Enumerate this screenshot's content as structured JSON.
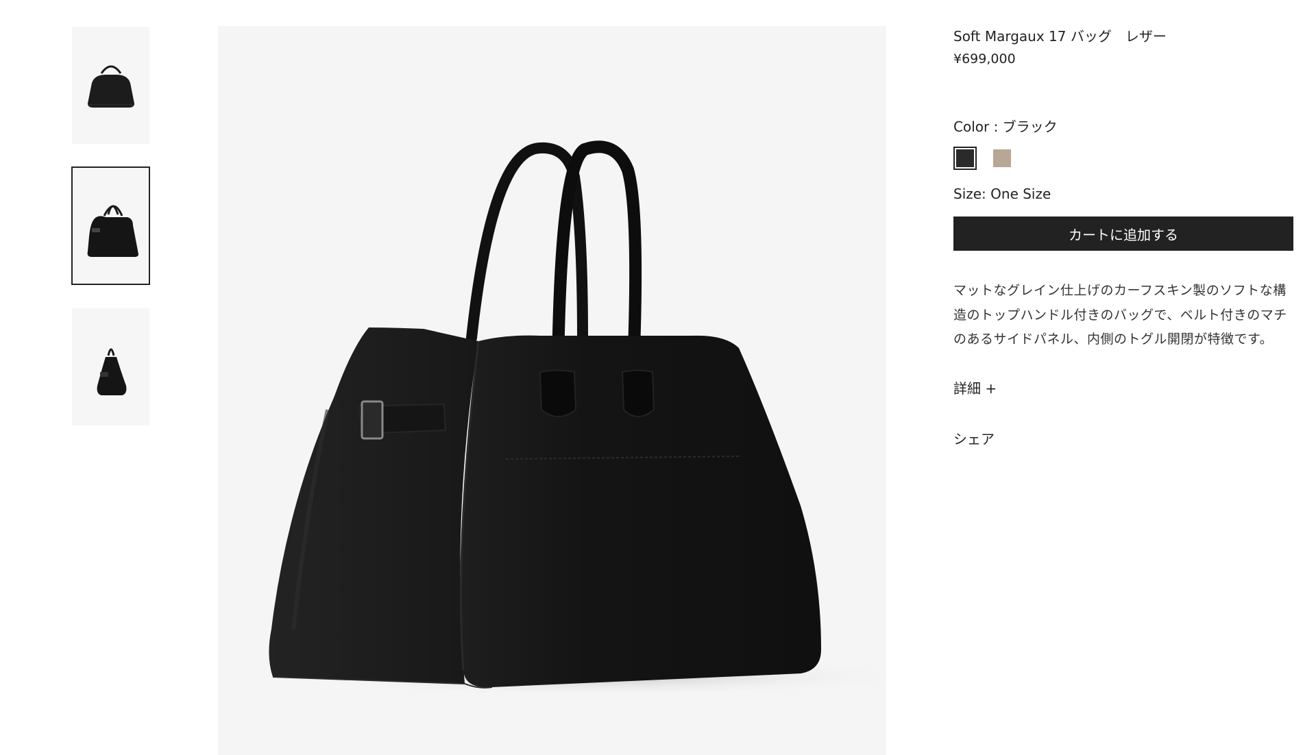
{
  "product": {
    "title": "Soft Margaux 17 バッグ　レザー",
    "price": "¥699,000"
  },
  "color": {
    "label": "Color : ブラック",
    "swatches": [
      {
        "name": "black",
        "hex": "#2a2a2a",
        "selected": true
      },
      {
        "name": "taupe",
        "hex": "#b7a794",
        "selected": false
      }
    ]
  },
  "size": {
    "label": "Size: One Size"
  },
  "actions": {
    "add_to_cart": "カートに追加する",
    "details": "詳細 +",
    "share": "シェア"
  },
  "description": "マットなグレイン仕上げのカーフスキン製のソフトな構造のトップハンドル付きのバッグで、ベルト付きのマチのあるサイドパネル、内側のトグル開閉が特徴です。",
  "thumbnails": [
    {
      "name": "front-view",
      "selected": false
    },
    {
      "name": "angled-view",
      "selected": true
    },
    {
      "name": "side-view",
      "selected": false
    }
  ],
  "colors": {
    "text": "#222222",
    "button_bg": "#222222",
    "button_text": "#ffffff",
    "image_bg": "#f5f5f5"
  }
}
